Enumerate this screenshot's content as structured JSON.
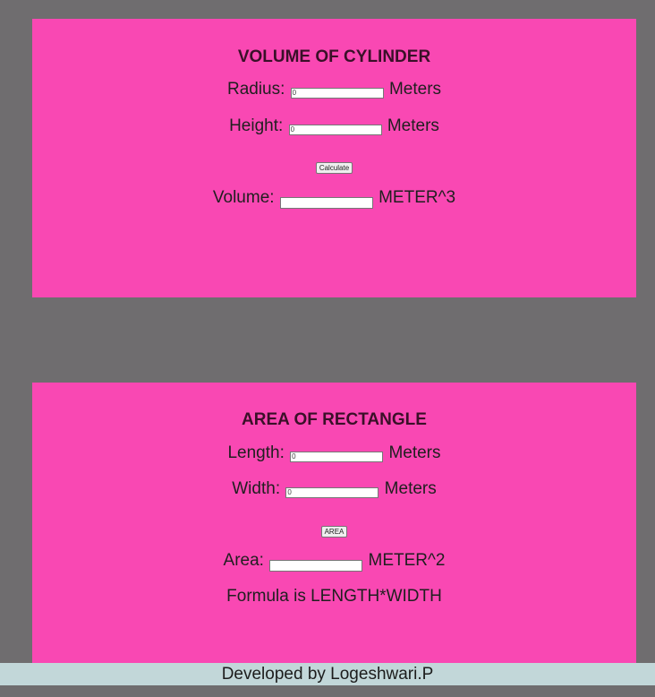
{
  "cylinder": {
    "title": "VOLUME OF CYLINDER",
    "radius_label": "Radius:",
    "radius_value": "0",
    "radius_unit": "Meters",
    "height_label": "Height:",
    "height_value": "0",
    "height_unit": "Meters",
    "calculate_label": "Calculate",
    "volume_label": "Volume:",
    "volume_value": "",
    "volume_unit": "METER^3"
  },
  "rectangle": {
    "title": "AREA OF RECTANGLE",
    "length_label": "Length:",
    "length_value": "0",
    "length_unit": "Meters",
    "width_label": "Width:",
    "width_value": "0",
    "width_unit": "Meters",
    "area_button_label": "AREA",
    "area_label": "Area:",
    "area_value": "",
    "area_unit": "METER^2",
    "formula_text": "Formula is LENGTH*WIDTH"
  },
  "footer": {
    "text": "Developed by Logeshwari.P"
  },
  "colors": {
    "page_background": "#6f6d6f",
    "panel_background": "#f948b3",
    "footer_background": "#c2d7d9"
  }
}
